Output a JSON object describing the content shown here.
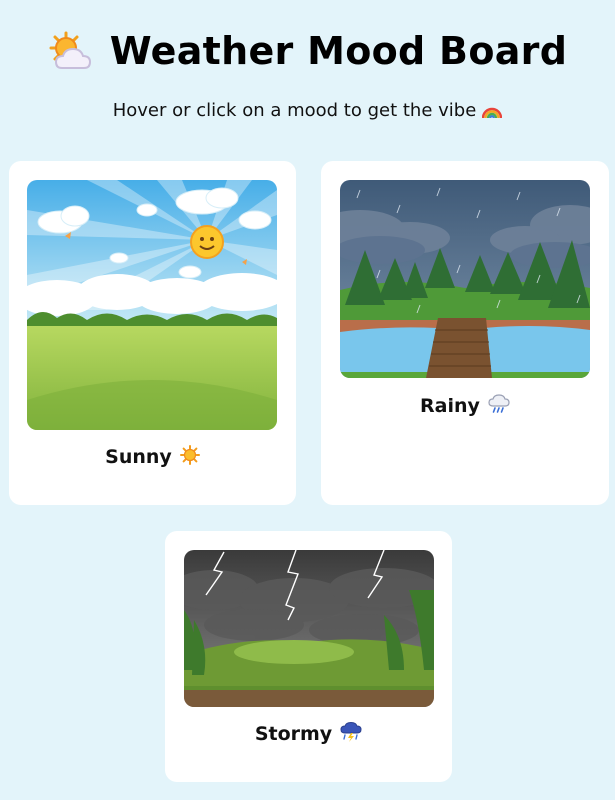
{
  "header": {
    "title": "Weather Mood Board",
    "title_icon": "sun-behind-cloud-icon",
    "subtitle": "Hover or click on a mood to get the vibe",
    "subtitle_icon": "rainbow-icon"
  },
  "moods": [
    {
      "label": "Sunny",
      "icon": "sun-icon",
      "image": "sunny-meadow-illustration"
    },
    {
      "label": "Rainy",
      "icon": "rain-cloud-icon",
      "image": "rainy-forest-lake-illustration"
    },
    {
      "label": "Stormy",
      "icon": "storm-cloud-icon",
      "image": "stormy-hill-illustration"
    }
  ],
  "colors": {
    "background": "#e3f4fa",
    "card": "#ffffff",
    "text": "#111111"
  }
}
